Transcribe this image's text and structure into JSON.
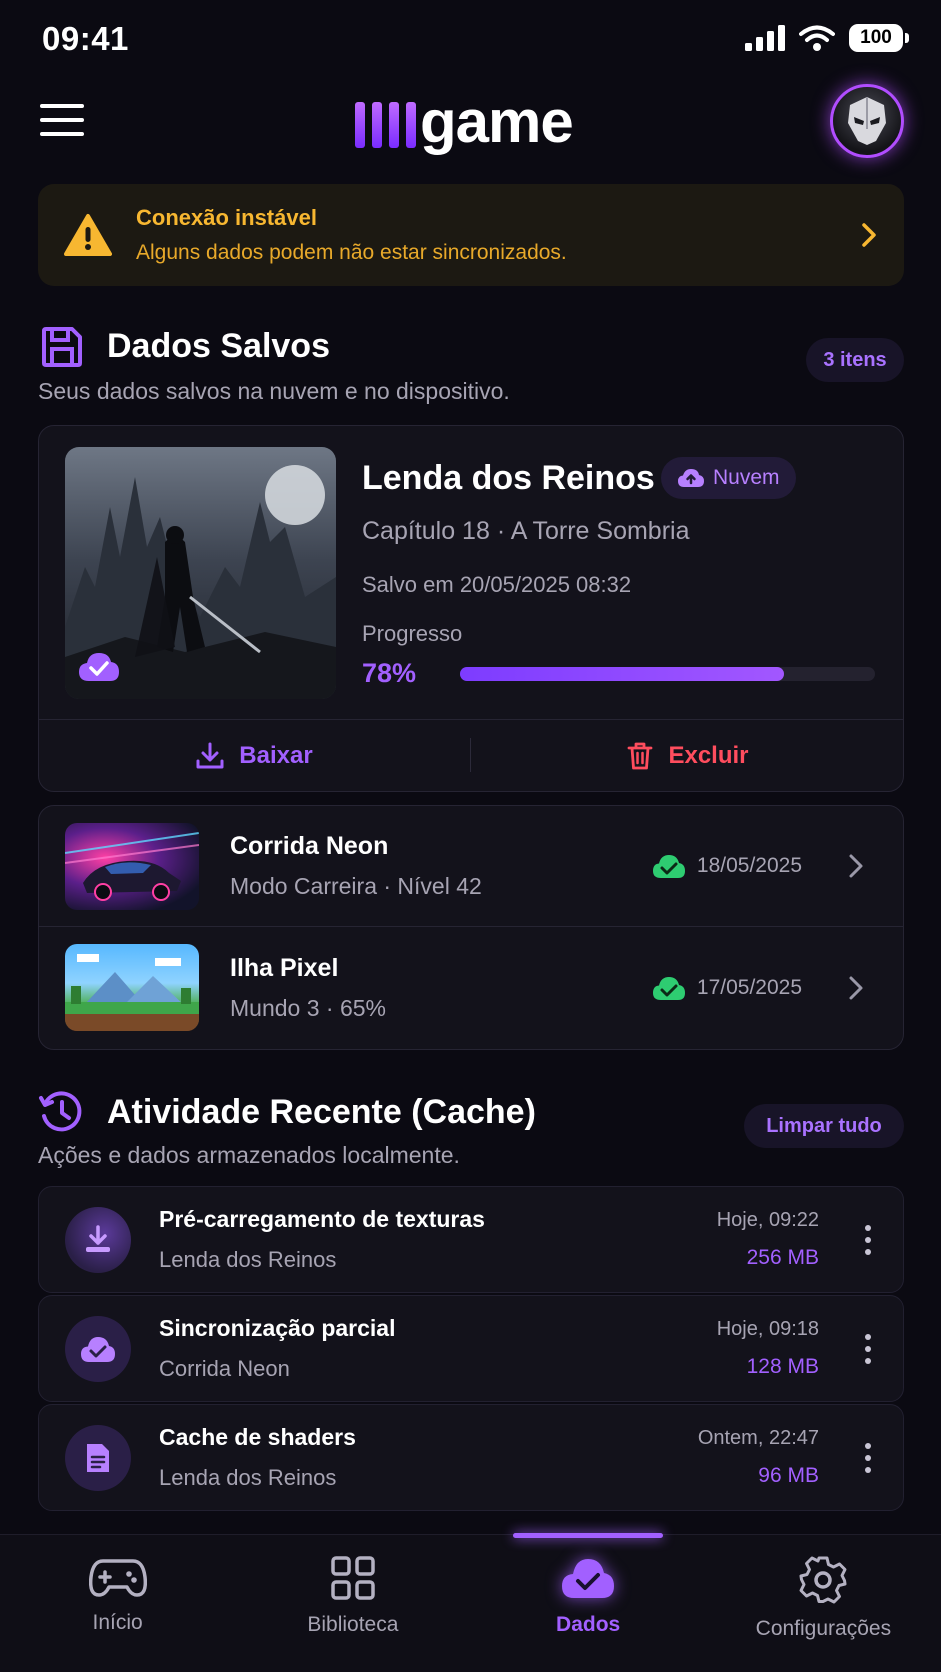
{
  "status_bar": {
    "time": "09:41",
    "battery": "100"
  },
  "header": {
    "logo_text": "game",
    "menu_icon": "hamburger-menu-icon",
    "avatar_icon": "masked-avatar"
  },
  "warning": {
    "title": "Conexão instável",
    "message": "Alguns dados podem não estar sincronizados.",
    "color": "#f7b731"
  },
  "saved_section": {
    "title": "Dados Salvos",
    "subtitle": "Seus dados salvos na nuvem e no dispositivo.",
    "count_label": "3 itens"
  },
  "main_save": {
    "title": "Lenda dos Reinos",
    "tag": "Nuvem",
    "chapter": "Capítulo 18 · A Torre Sombria",
    "saved_at": "Salvo em 20/05/2025 08:32",
    "progress_label": "Progresso",
    "progress_text": "78%",
    "progress": 0.78,
    "download_label": "Baixar",
    "delete_label": "Excluir"
  },
  "save_list": [
    {
      "title": "Corrida Neon",
      "subtitle": "Modo Carreira · Nível 42",
      "date": "18/05/2025"
    },
    {
      "title": "Ilha Pixel",
      "subtitle": "Mundo 3 · 65%",
      "date": "17/05/2025"
    }
  ],
  "activity_section": {
    "title": "Atividade Recente (Cache)",
    "subtitle": "Ações e dados armazenados localmente.",
    "clear_label": "Limpar tudo"
  },
  "cache_items": [
    {
      "title": "Pré-carregamento de texturas",
      "game": "Lenda dos Reinos",
      "time": "Hoje, 09:22",
      "size": "256 MB",
      "icon": "download-icon"
    },
    {
      "title": "Sincronização parcial",
      "game": "Corrida Neon",
      "time": "Hoje, 09:18",
      "size": "128 MB",
      "icon": "cloud-check-icon"
    },
    {
      "title": "Cache de shaders",
      "game": "Lenda dos Reinos",
      "time": "Ontem, 22:47",
      "size": "96 MB",
      "icon": "document-icon"
    }
  ],
  "bottom_nav": [
    {
      "label": "Início",
      "icon": "gamepad-icon"
    },
    {
      "label": "Biblioteca",
      "icon": "grid-icon"
    },
    {
      "label": "Dados",
      "icon": "cloud-check-icon",
      "active": true
    },
    {
      "label": "Configurações",
      "icon": "gear-icon"
    }
  ],
  "colors": {
    "accent": "#a260ff",
    "success": "#2ecc71",
    "danger": "#ff4d5e",
    "background": "#0b0a12"
  }
}
